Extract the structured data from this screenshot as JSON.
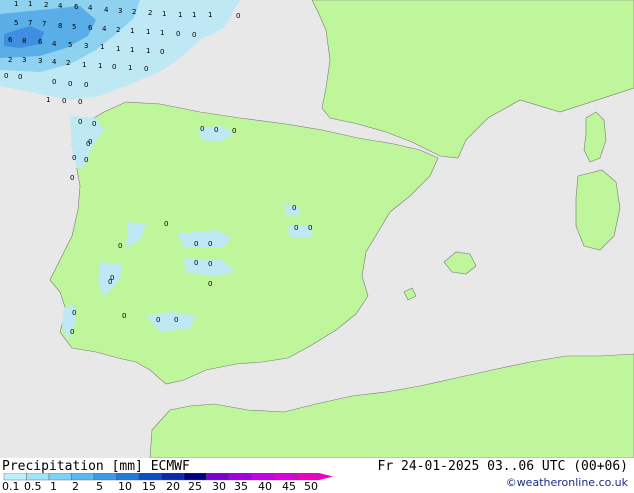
{
  "footer": {
    "title": "Precipitation [mm] ECMWF",
    "datetime": "Fr 24-01-2025 03..06 UTC (00+06)",
    "credit": "©weatheronline.co.uk",
    "scale_labels": [
      "0.1",
      "0.5",
      "1",
      "2",
      "5",
      "10",
      "15",
      "20",
      "25",
      "30",
      "35",
      "40",
      "45",
      "50"
    ]
  },
  "colors": {
    "sea": "#e8e8e8",
    "land": "#bff59b",
    "border": "#7a7a7a",
    "precip_light": "#bfe8f5",
    "precip_mid": "#8fd2f0",
    "precip_heavy": "#5aaee8",
    "precip_max": "#3f8fe0",
    "scale": [
      "#bdf0ff",
      "#9fe4fb",
      "#7cd2f7",
      "#5ab8f0",
      "#3c9be6",
      "#1f7ad9",
      "#0b4fc0",
      "#0a2aa8",
      "#000080",
      "#7b00d6",
      "#a000e0",
      "#c300e6",
      "#dd00dd",
      "#f000c0"
    ]
  },
  "map_values": [
    {
      "text": "1"
    },
    {
      "text": "1"
    },
    {
      "text": "2"
    },
    {
      "text": "4"
    },
    {
      "text": "6"
    },
    {
      "text": "4"
    },
    {
      "text": "4"
    },
    {
      "text": "3"
    },
    {
      "text": "2"
    },
    {
      "text": "2"
    },
    {
      "text": "1"
    },
    {
      "text": "1"
    },
    {
      "text": "1"
    },
    {
      "text": "1"
    },
    {
      "text": "0"
    },
    {
      "text": "5"
    },
    {
      "text": "7"
    },
    {
      "text": "7"
    },
    {
      "text": "8"
    },
    {
      "text": "5"
    },
    {
      "text": "6"
    },
    {
      "text": "4"
    },
    {
      "text": "2"
    },
    {
      "text": "1"
    },
    {
      "text": "1"
    },
    {
      "text": "1"
    },
    {
      "text": "0"
    },
    {
      "text": "0"
    },
    {
      "text": "6"
    },
    {
      "text": "8"
    },
    {
      "text": "6"
    },
    {
      "text": "4"
    },
    {
      "text": "5"
    },
    {
      "text": "3"
    },
    {
      "text": "1"
    },
    {
      "text": "1"
    },
    {
      "text": "1"
    },
    {
      "text": "1"
    },
    {
      "text": "0"
    },
    {
      "text": "2"
    },
    {
      "text": "3"
    },
    {
      "text": "3"
    },
    {
      "text": "4"
    },
    {
      "text": "2"
    },
    {
      "text": "1"
    },
    {
      "text": "1"
    },
    {
      "text": "0"
    },
    {
      "text": "1"
    },
    {
      "text": "0"
    },
    {
      "text": "0"
    },
    {
      "text": "0"
    },
    {
      "text": "0"
    },
    {
      "text": "0"
    },
    {
      "text": "0"
    },
    {
      "text": "1"
    },
    {
      "text": "0"
    },
    {
      "text": "0"
    },
    {
      "text": "0"
    },
    {
      "text": "0"
    },
    {
      "text": "0"
    },
    {
      "text": "0"
    },
    {
      "text": "0"
    },
    {
      "text": "0"
    },
    {
      "text": "0"
    },
    {
      "text": "0"
    },
    {
      "text": "0"
    },
    {
      "text": "0"
    },
    {
      "text": "0"
    },
    {
      "text": "0"
    },
    {
      "text": "0"
    },
    {
      "text": "0"
    },
    {
      "text": "0"
    },
    {
      "text": "0"
    },
    {
      "text": "0"
    },
    {
      "text": "0"
    },
    {
      "text": "0"
    },
    {
      "text": "0"
    },
    {
      "text": "0"
    },
    {
      "text": "0"
    },
    {
      "text": "0"
    },
    {
      "text": "0"
    },
    {
      "text": "0"
    },
    {
      "text": "0"
    },
    {
      "text": "0"
    }
  ]
}
